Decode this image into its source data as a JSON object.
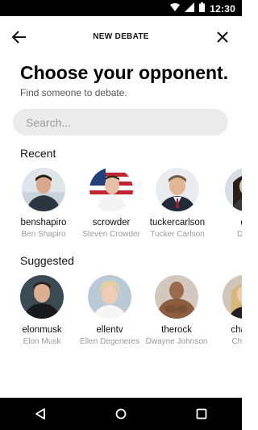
{
  "status_bar": {
    "time": "12:30",
    "icons": [
      "wifi-icon",
      "signal-icon",
      "battery-icon"
    ]
  },
  "app_bar": {
    "title": "NEW DEBATE",
    "back_icon": "arrow-left-icon",
    "close_icon": "close-icon"
  },
  "headline": "Choose your opponent.",
  "subheadline": "Find someone to debate.",
  "search": {
    "placeholder": "Search...",
    "value": ""
  },
  "recent": {
    "title": "Recent",
    "people": [
      {
        "username": "benshapiro",
        "name": "Ben Shapiro"
      },
      {
        "username": "scrowder",
        "name": "Steven Crowder"
      },
      {
        "username": "tuckercarlson",
        "name": "Tucker Carlson"
      },
      {
        "username": "dlo",
        "name": "Dana"
      }
    ]
  },
  "suggested": {
    "title": "Suggested",
    "people": [
      {
        "username": "elonmusk",
        "name": "Elon Musk"
      },
      {
        "username": "ellentv",
        "name": "Ellen Degeneres"
      },
      {
        "username": "therock",
        "name": "Dwayne Johnson"
      },
      {
        "username": "charliz",
        "name": "Charliz"
      }
    ]
  },
  "nav": {
    "icons": [
      "back-triangle-icon",
      "home-circle-icon",
      "recents-square-icon"
    ]
  },
  "colors": {
    "background": "#ffffff",
    "search_bg": "#ebebeb",
    "secondary_text": "#9a9a9a",
    "bars": "#000000"
  }
}
